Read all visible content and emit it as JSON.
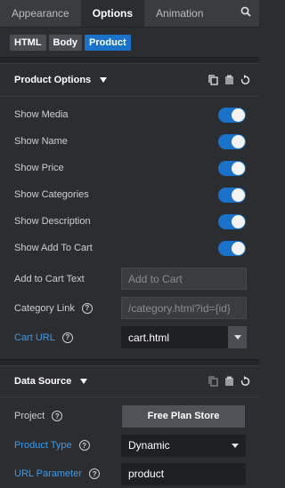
{
  "tabs": [
    {
      "label": "Appearance"
    },
    {
      "label": "Options"
    },
    {
      "label": "Animation"
    }
  ],
  "breadcrumb": [
    "HTML",
    "Body",
    "Product"
  ],
  "product_options": {
    "title": "Product Options",
    "toggles": [
      {
        "label": "Show Media",
        "on": true
      },
      {
        "label": "Show Name",
        "on": true
      },
      {
        "label": "Show Price",
        "on": true
      },
      {
        "label": "Show Categories",
        "on": true
      },
      {
        "label": "Show Description",
        "on": true
      },
      {
        "label": "Show Add To Cart",
        "on": true
      }
    ],
    "add_to_cart_text": {
      "label": "Add to Cart Text",
      "placeholder": "Add to Cart"
    },
    "category_link": {
      "label": "Category Link",
      "placeholder": "/category.html?id={id}"
    },
    "cart_url": {
      "label": "Cart URL",
      "value": "cart.html"
    }
  },
  "data_source": {
    "title": "Data Source",
    "project": {
      "label": "Project",
      "button": "Free Plan Store"
    },
    "product_type": {
      "label": "Product Type",
      "value": "Dynamic"
    },
    "url_parameter": {
      "label": "URL Parameter",
      "value": "product"
    }
  },
  "colors": {
    "accent": "#1a73c9",
    "link_label": "#3d9be9"
  }
}
